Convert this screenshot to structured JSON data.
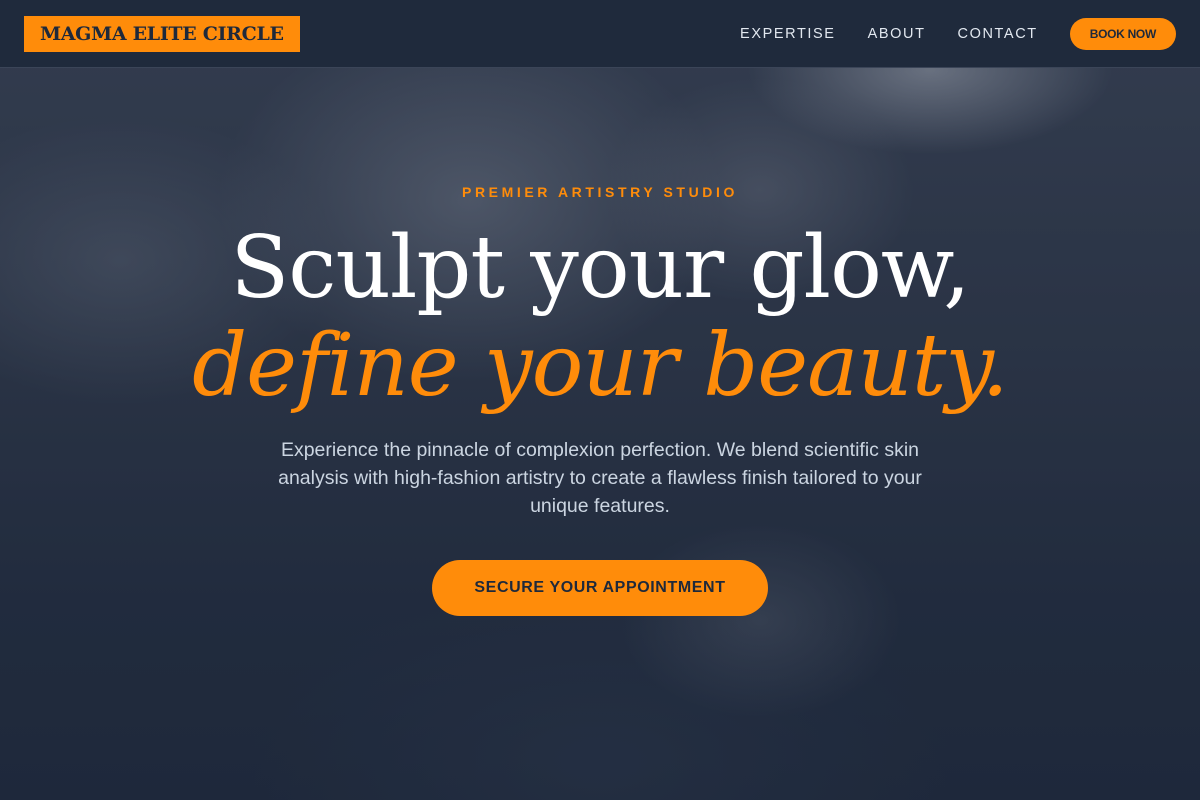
{
  "header": {
    "logo": "MAGMA ELITE CIRCLE",
    "nav": [
      "EXPERTISE",
      "ABOUT",
      "CONTACT"
    ],
    "book_label": "BOOK NOW"
  },
  "hero": {
    "eyebrow": "PREMIER ARTISTRY STUDIO",
    "headline_line1": "Sculpt your glow,",
    "headline_line2": "define your beauty.",
    "description": "Experience the pinnacle of complexion perfection. We blend scientific skin analysis with high-fashion artistry to create a flawless finish tailored to your unique features.",
    "cta_label": "SECURE YOUR APPOINTMENT"
  },
  "colors": {
    "accent": "#ff8c0a",
    "header_bg": "#1f2a3c",
    "overlay": "#1e293b",
    "heading": "#ffffff",
    "body_text": "#cbd5e1"
  }
}
